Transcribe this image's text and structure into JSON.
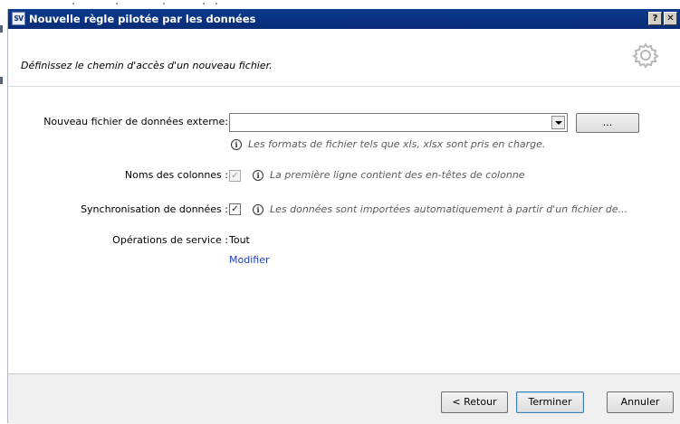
{
  "window": {
    "title": "Nouvelle règle pilotée par les données",
    "app_icon_text": "SV",
    "help_label": "?",
    "close_label": "✕"
  },
  "header": {
    "description": "Définissez le chemin d'accès d'un nouveau fichier.",
    "icon": "gear-icon"
  },
  "form": {
    "external_file": {
      "label": "Nouveau fichier de données externe:",
      "value": "",
      "browse_label": "...",
      "hint": "Les formats de fichier tels que xls, xlsx sont pris en charge."
    },
    "column_names": {
      "label": "Noms des colonnes :",
      "checked": true,
      "enabled": false,
      "hint": "La première ligne contient des en-têtes de colonne"
    },
    "data_sync": {
      "label": "Synchronisation de données :",
      "checked": true,
      "enabled": true,
      "hint": "Les données sont importées automatiquement à partir d'un fichier de..."
    },
    "service_operations": {
      "label": "Opérations de service :",
      "value": "Tout",
      "link": "Modifier"
    }
  },
  "footer": {
    "back_label": "< Retour",
    "finish_label": "Terminer",
    "cancel_label": "Annuler"
  },
  "colors": {
    "titlebar": "#0a2c78",
    "link": "#1f3fc7",
    "footer_bg": "#f0f0f0"
  }
}
